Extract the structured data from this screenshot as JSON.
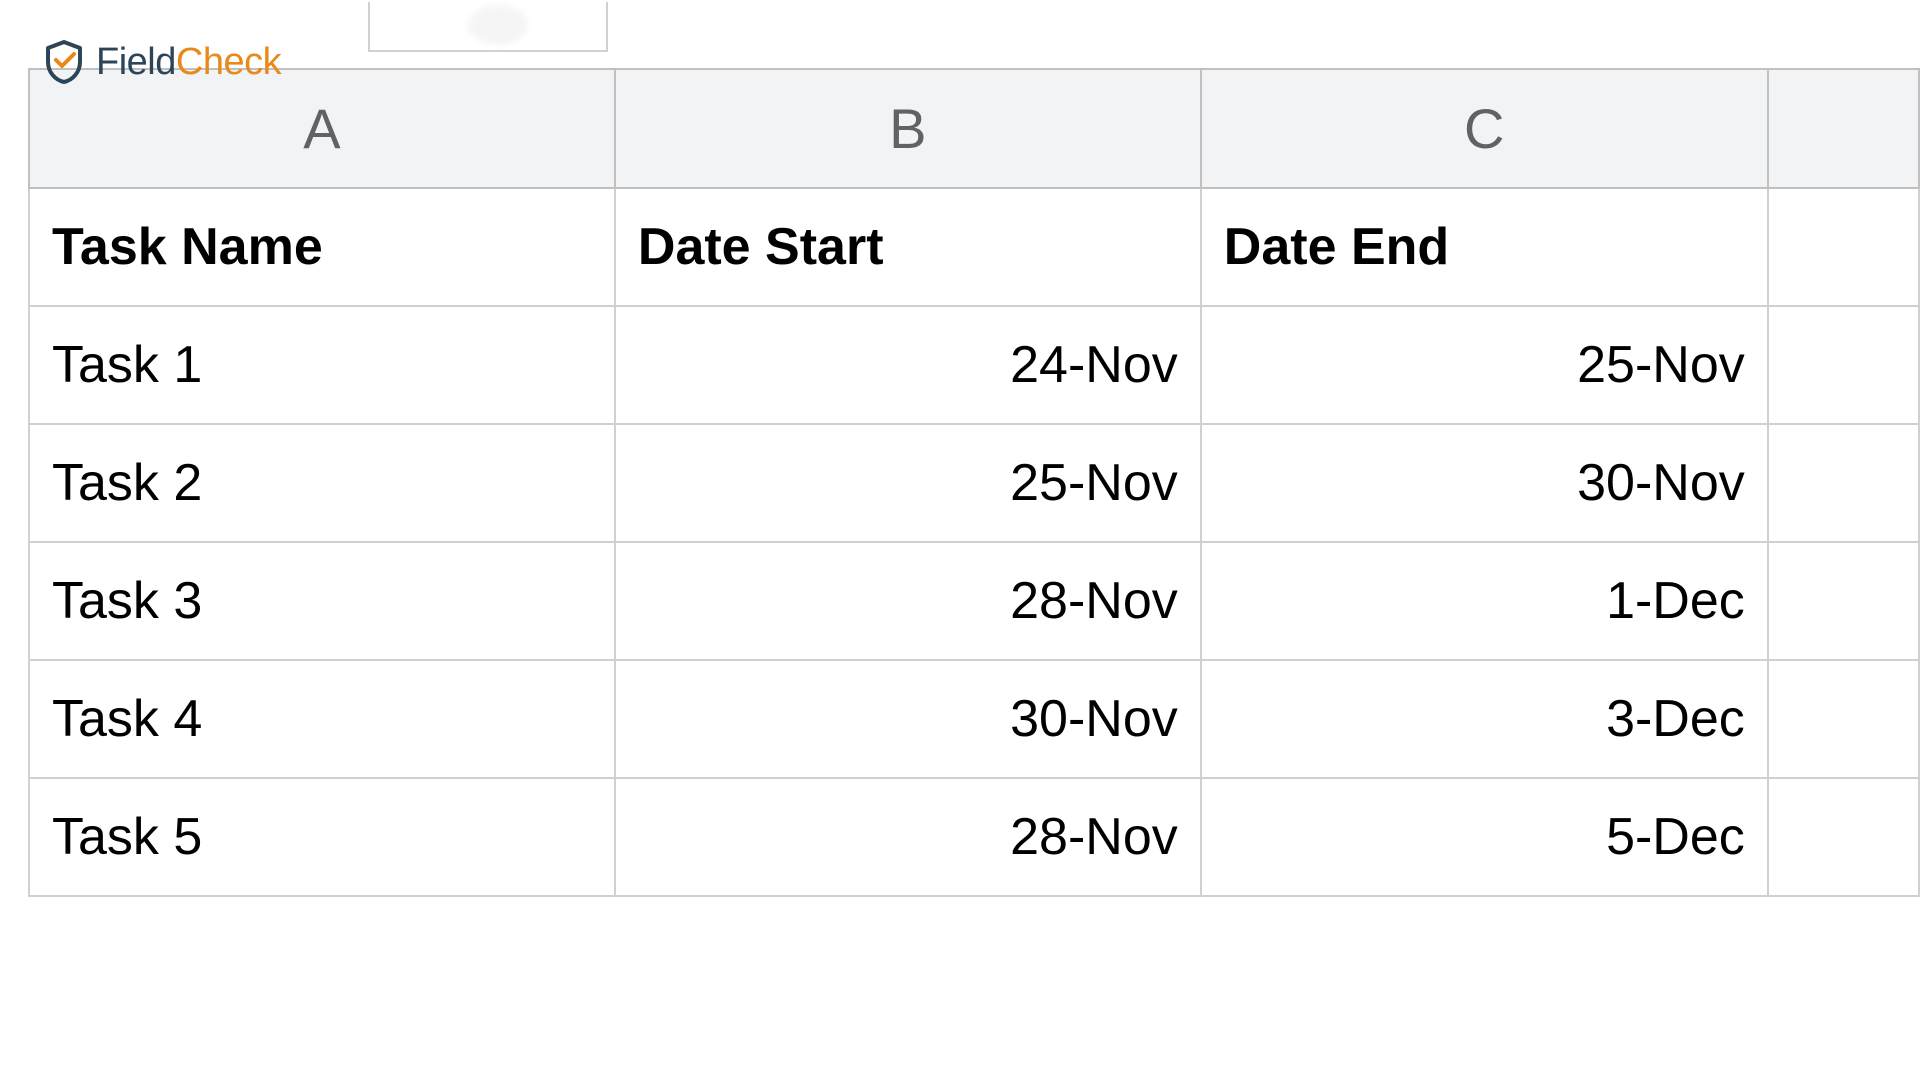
{
  "logo": {
    "field": "Field",
    "check": "Check"
  },
  "columns": {
    "a": "A",
    "b": "B",
    "c": "C"
  },
  "headers": {
    "task_name": "Task Name",
    "date_start": "Date Start",
    "date_end": "Date End"
  },
  "rows": [
    {
      "task": "Task 1",
      "start": "24-Nov",
      "end": "25-Nov"
    },
    {
      "task": "Task 2",
      "start": "25-Nov",
      "end": "30-Nov"
    },
    {
      "task": "Task 3",
      "start": "28-Nov",
      "end": "1-Dec"
    },
    {
      "task": "Task 4",
      "start": "30-Nov",
      "end": "3-Dec"
    },
    {
      "task": "Task 5",
      "start": "28-Nov",
      "end": "5-Dec"
    }
  ]
}
